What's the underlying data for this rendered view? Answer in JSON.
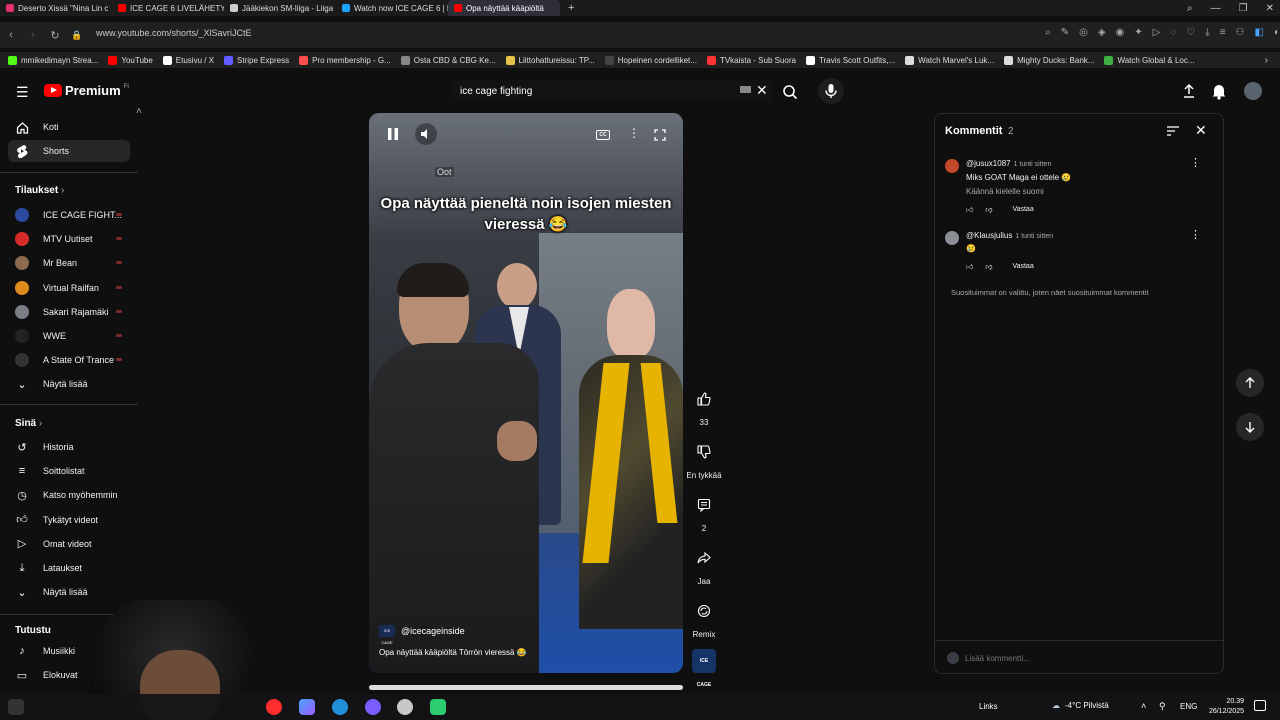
{
  "browser": {
    "tabs": [
      {
        "title": "Deserto Xissä \"Nina Lin c",
        "color": "#e1306c"
      },
      {
        "title": "ICE CAGE 6 LIVELÄHETYS",
        "color": "#ff0000"
      },
      {
        "title": "Jääkiekon SM-liiga - Liiga",
        "color": "#cccccc"
      },
      {
        "title": "Watch now ICE CAGE 6 | L",
        "color": "#1aa3ff"
      },
      {
        "title": "Opa näyttää kääpiöltä",
        "color": "#ff0000"
      }
    ],
    "new_tab": "+",
    "url": "www.youtube.com/shorts/_XlSavriJCtE",
    "bookmarks": [
      {
        "label": "mmikedimayn Strea...",
        "color": "#53fc18"
      },
      {
        "label": "YouTube",
        "color": "#ff0000"
      },
      {
        "label": "Etusivu / X",
        "color": "#ffffff"
      },
      {
        "label": "Stripe Express",
        "color": "#635bff"
      },
      {
        "label": "Pro membership - G...",
        "color": "#ff4d4d"
      },
      {
        "label": "Osta CBD & CBG Ke...",
        "color": "#888888"
      },
      {
        "label": "Liittohattureissu: TP...",
        "color": "#e8c34a"
      },
      {
        "label": "Hopeinen cordelliket...",
        "color": "#444444"
      },
      {
        "label": "TVkaista - Sub Suora",
        "color": "#ff3333"
      },
      {
        "label": "Travis Scott Outfits,...",
        "color": "#ffffff"
      },
      {
        "label": "Watch Marvel's Luk...",
        "color": "#dddddd"
      },
      {
        "label": "Mighty Ducks: Bank...",
        "color": "#dddddd"
      },
      {
        "label": "Watch Global & Loc...",
        "color": "#3cb043"
      }
    ]
  },
  "header": {
    "logo": "Premium",
    "logo_region": "FI",
    "search_value": "ice cage fighting"
  },
  "sidebar": {
    "main": [
      {
        "label": "Koti",
        "icon": "home-icon"
      },
      {
        "label": "Shorts",
        "icon": "shorts-icon"
      }
    ],
    "subs_heading": "Tilaukset",
    "subs": [
      {
        "label": "ICE CAGE FIGHT...",
        "color": "#2a4aa0"
      },
      {
        "label": "MTV Uutiset",
        "color": "#d62b2b"
      },
      {
        "label": "Mr Bean",
        "color": "#8a6b50"
      },
      {
        "label": "Virtual Railfan",
        "color": "#e08a1e"
      },
      {
        "label": "Sakari Rajamäki",
        "color": "#7a7f86"
      },
      {
        "label": "WWE",
        "color": "#222222"
      },
      {
        "label": "A State Of Trance",
        "color": "#333333"
      }
    ],
    "show_more": "Näytä lisää",
    "you_heading": "Sinä",
    "you": [
      {
        "label": "Historia",
        "icon": "history-icon"
      },
      {
        "label": "Soittolistat",
        "icon": "playlists-icon"
      },
      {
        "label": "Katso myöhemmin",
        "icon": "watch-later-icon"
      },
      {
        "label": "Tykätyt videot",
        "icon": "liked-icon"
      },
      {
        "label": "Omat videot",
        "icon": "your-videos-icon"
      },
      {
        "label": "Lataukset",
        "icon": "downloads-icon"
      },
      {
        "label": "Näytä lisää",
        "icon": "chevron-down-icon"
      }
    ],
    "explore_heading": "Tutustu",
    "explore": [
      {
        "label": "Musiikki",
        "icon": "music-icon"
      },
      {
        "label": "Elokuvat",
        "icon": "movies-icon"
      }
    ]
  },
  "player": {
    "overlay_label": "Oot",
    "caption": "Opa näyttää pieneltä noin isojen miesten vieressä 😂",
    "channel": "@icecageinside",
    "channel_badge": "ICE CAGE",
    "description": "Opa näyttää kääpiöltä Törrön vieressä 😂"
  },
  "actions": {
    "likes": "33",
    "dislike": "En tykkää",
    "comments": "2",
    "share": "Jaa",
    "remix": "Remix",
    "channel_thumb": "ICE CAGE"
  },
  "comments": {
    "title": "Kommentit",
    "count": "2",
    "items": [
      {
        "user": "@jusux1087",
        "time": "1 tunti sitten",
        "text": "Miks GOAT Maga ei ottele 😢",
        "translate": "Käännä kielelle suomi",
        "reply": "Vastaa",
        "color": "#c24a2a"
      },
      {
        "user": "@Klausjulius",
        "time": "1 tunti sitten",
        "text": "😢",
        "reply": "Vastaa",
        "color": "#8a8f96"
      }
    ],
    "note": "Suosituimmat on valittu, joten näet suosituimmat kommentit",
    "add_placeholder": "Lisää kommentti..."
  },
  "taskbar": {
    "links": "Links",
    "weather": "-4°C Pilvistä",
    "lang": "ENG",
    "time": "20.39",
    "date": "26/12/2025"
  }
}
